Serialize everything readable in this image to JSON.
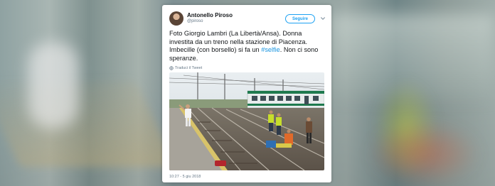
{
  "tweet": {
    "author_name": "Antonello Piroso",
    "author_handle": "@piroso",
    "follow_label": "Seguire",
    "text_main": "Foto Giorgio Lambri (La Libertà/Ansa). Donna investita da un treno nella stazione di Piacenza. Imbecille (con borsello) si fa un ",
    "hashtag": "#selfie",
    "text_after": ". Non ci sono speranze.",
    "translate_label": "Traduci il Tweet",
    "timestamp": "10:27 - 5 giu 2018"
  },
  "icons": {
    "avatar": "profile-avatar",
    "chevron": "chevron-down-icon",
    "translate": "globe-icon"
  },
  "colors": {
    "accent": "#1da1f2",
    "hashtag": "#1b95e0",
    "muted": "#657786",
    "text": "#14171a"
  }
}
